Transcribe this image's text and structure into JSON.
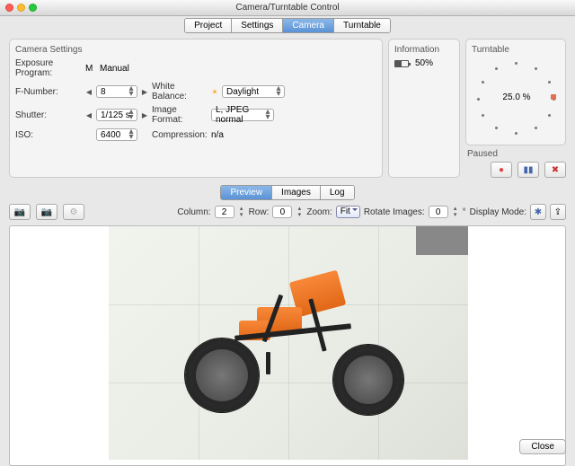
{
  "window": {
    "title": "Camera/Turntable Control"
  },
  "mainTabs": [
    "Project",
    "Settings",
    "Camera",
    "Turntable"
  ],
  "mainTabSelected": 2,
  "cameraSettings": {
    "header": "Camera Settings",
    "exposureProgram": {
      "label": "Exposure Program:",
      "prefix": "M",
      "value": "Manual"
    },
    "fNumber": {
      "label": "F-Number:",
      "value": "8"
    },
    "whiteBalance": {
      "label": "White Balance:",
      "value": "Daylight"
    },
    "shutter": {
      "label": "Shutter:",
      "value": "1/125 s"
    },
    "imageFormat": {
      "label": "Image Format:",
      "value": "L, JPEG normal"
    },
    "iso": {
      "label": "ISO:",
      "value": "6400"
    },
    "compression": {
      "label": "Compression:",
      "value": "n/a"
    }
  },
  "information": {
    "header": "Information",
    "battery": "50%"
  },
  "turntable": {
    "header": "Turntable",
    "progress": "25.0 %",
    "paused": "Paused"
  },
  "viewTabs": [
    "Preview",
    "Images",
    "Log"
  ],
  "viewTabSelected": 0,
  "toolbar": {
    "columnLabel": "Column:",
    "columnValue": "2",
    "rowLabel": "Row:",
    "rowValue": "0",
    "zoomLabel": "Zoom:",
    "zoomValue": "Fit",
    "rotateLabel": "Rotate Images:",
    "rotateValue": "0",
    "rotateUnit": "°",
    "displayLabel": "Display Mode:"
  },
  "footer": {
    "close": "Close"
  }
}
